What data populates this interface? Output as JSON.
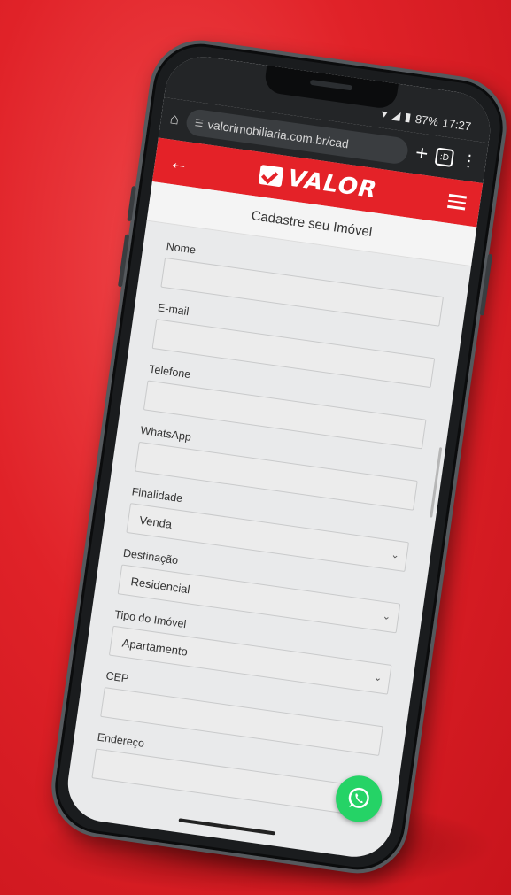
{
  "status": {
    "signal_icon": "signal-icon",
    "battery": "87%",
    "time": "17:27"
  },
  "browser": {
    "url": "valorimobiliaria.com.br/cad",
    "tab_count": ":D"
  },
  "site": {
    "logo_text": "VALOR"
  },
  "page": {
    "title": "Cadastre seu Imóvel"
  },
  "form": {
    "nome_label": "Nome",
    "email_label": "E-mail",
    "telefone_label": "Telefone",
    "whatsapp_label": "WhatsApp",
    "finalidade_label": "Finalidade",
    "finalidade_value": "Venda",
    "destinacao_label": "Destinação",
    "destinacao_value": "Residencial",
    "tipo_label": "Tipo do Imóvel",
    "tipo_value": "Apartamento",
    "cep_label": "CEP",
    "endereco_label": "Endereço"
  },
  "colors": {
    "brand_red": "#e42228",
    "whatsapp_green": "#25d366"
  }
}
